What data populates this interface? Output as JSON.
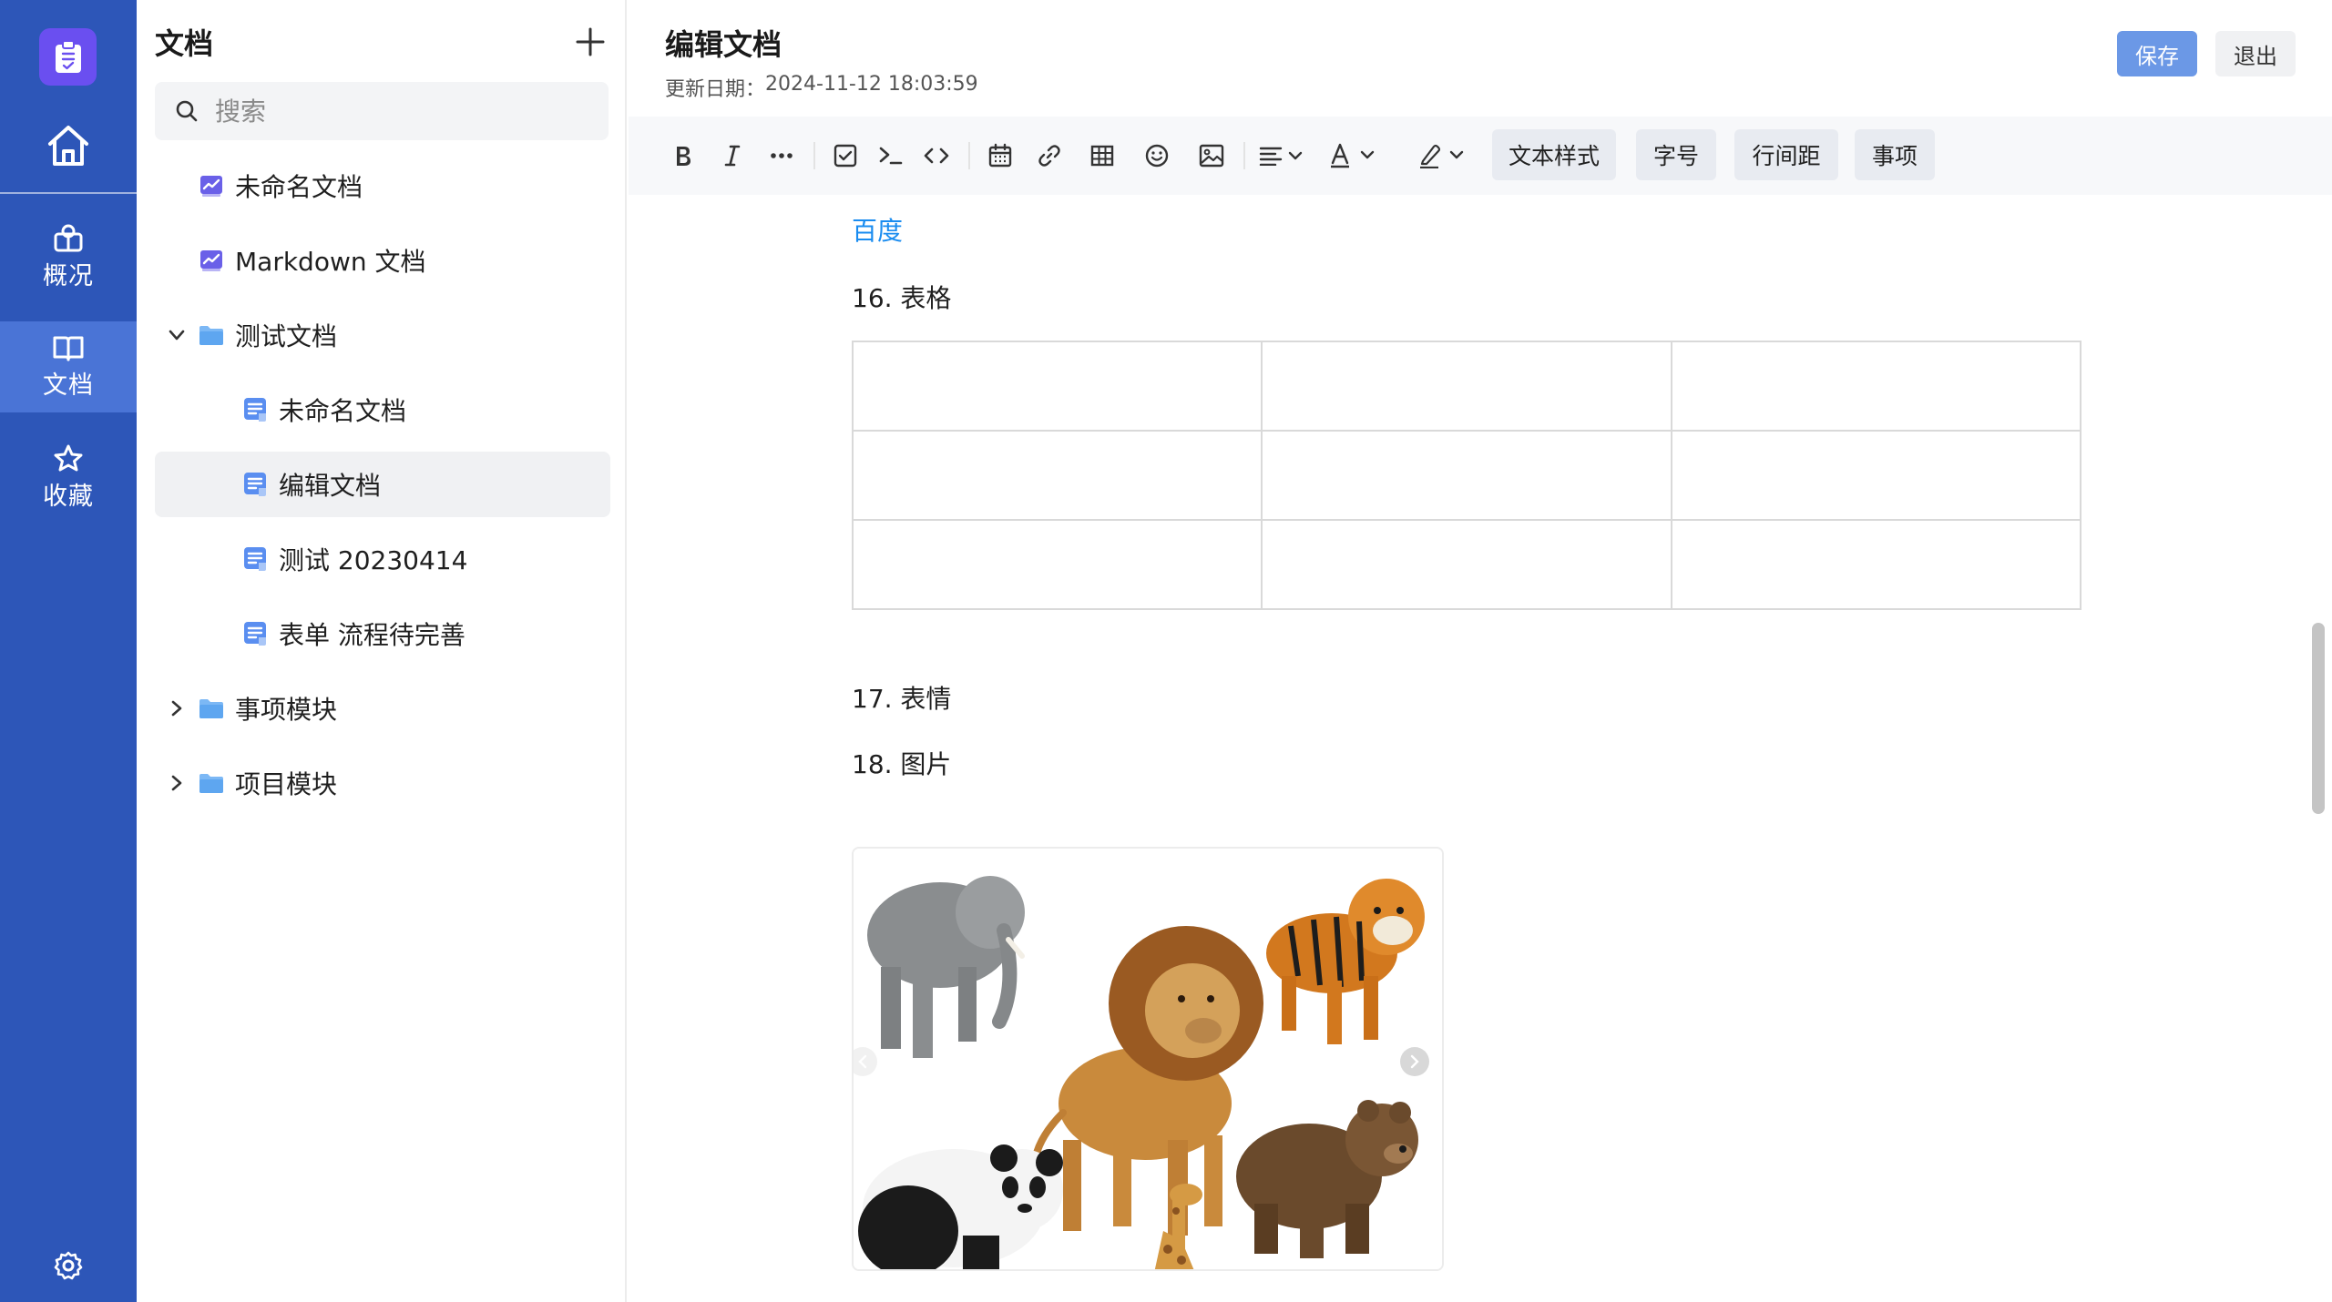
{
  "rail": {
    "logo_icon": "clipboard-check-icon",
    "home_icon": "home-icon",
    "items": [
      {
        "label": "概况",
        "icon": "overview-icon"
      },
      {
        "label": "文档",
        "icon": "book-icon"
      },
      {
        "label": "收藏",
        "icon": "star-icon"
      }
    ],
    "settings_icon": "gear-icon",
    "colors": {
      "bg": "#2d56b8",
      "active": "#4a74d6",
      "logo": "#6a4ff0"
    }
  },
  "tree": {
    "title": "文档",
    "search_placeholder": "搜索",
    "items": [
      {
        "label": "未命名文档",
        "type": "doc-chart"
      },
      {
        "label": "Markdown 文档",
        "type": "doc-chart"
      },
      {
        "label": "测试文档",
        "type": "folder",
        "expanded": true
      },
      {
        "label": "未命名文档",
        "type": "doc"
      },
      {
        "label": "编辑文档",
        "type": "doc",
        "selected": true
      },
      {
        "label": "测试 20230414",
        "type": "doc"
      },
      {
        "label": "表单 流程待完善",
        "type": "doc"
      },
      {
        "label": "事项模块",
        "type": "folder",
        "expanded": false
      },
      {
        "label": "项目模块",
        "type": "folder",
        "expanded": false
      }
    ]
  },
  "editor": {
    "title": "编辑文档",
    "updated_label": "更新日期：",
    "updated_value": "2024-11-12 18:03:59",
    "save_label": "保存",
    "exit_label": "退出",
    "toolbar": {
      "pills": [
        "文本样式",
        "字号",
        "行间距",
        "事项"
      ]
    },
    "content": {
      "link_text": "百度",
      "heading_16": "16. 表格",
      "heading_17": "17. 表情",
      "heading_18": "18. 图片",
      "table": {
        "rows": 3,
        "cols": 3
      }
    }
  }
}
